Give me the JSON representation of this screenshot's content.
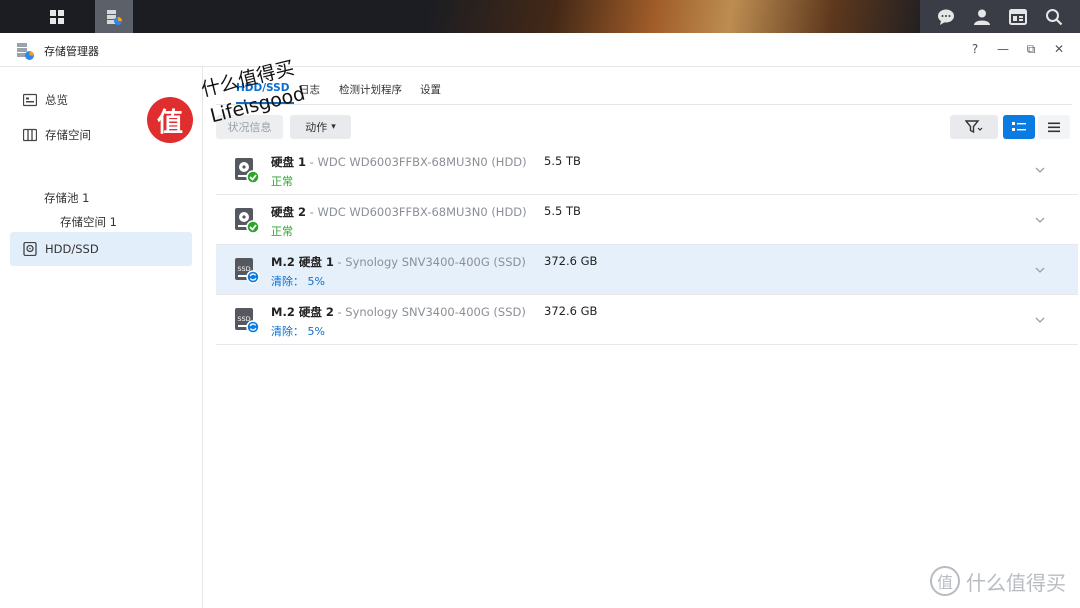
{
  "taskbar": {
    "apps": [
      {
        "icon": "main-menu-grid-icon"
      },
      {
        "icon": "storage-manager-icon",
        "active": true
      }
    ],
    "right_icons": [
      "chat-icon",
      "user-icon",
      "widgets-icon",
      "search-icon"
    ]
  },
  "window": {
    "title": "存储管理器",
    "controls": {
      "help": "?",
      "minimize": "—",
      "restore": "⧉",
      "close": "✕"
    }
  },
  "sidebar": {
    "items": [
      {
        "label": "总览",
        "icon": "overview-icon"
      },
      {
        "label": "存储空间",
        "icon": "storage-space-icon",
        "expanded": true
      },
      {
        "label": "HDD/SSD",
        "icon": "hdd-icon",
        "selected": true
      }
    ],
    "sub_items": [
      {
        "label": "存储池 1"
      },
      {
        "label": "存储空间 1"
      }
    ]
  },
  "tabs": [
    {
      "label": "HDD/SSD",
      "active": true
    },
    {
      "label": "日志"
    },
    {
      "label": "检测计划程序"
    },
    {
      "label": "设置"
    }
  ],
  "toolbar": {
    "status_info": "状况信息",
    "action": "动作",
    "action_caret": "▾"
  },
  "disks": [
    {
      "name": "硬盘 1",
      "model": " - WDC WD6003FFBX-68MU3N0 (HDD)",
      "size": "5.5 TB",
      "status": "正常",
      "status_type": "ok",
      "type": "hdd"
    },
    {
      "name": "硬盘 2",
      "model": " - WDC WD6003FFBX-68MU3N0 (HDD)",
      "size": "5.5 TB",
      "status": "正常",
      "status_type": "ok",
      "type": "hdd"
    },
    {
      "name": "M.2 硬盘 1",
      "model": " - Synology SNV3400-400G (SSD)",
      "size": "372.6 GB",
      "status": "清除：  5%",
      "status_type": "info",
      "type": "ssd",
      "highlight": true
    },
    {
      "name": "M.2 硬盘 2",
      "model": " - Synology SNV3400-400G (SSD)",
      "size": "372.6 GB",
      "status": "清除：  5%",
      "status_type": "info",
      "type": "ssd"
    }
  ],
  "watermark": {
    "logo_char": "值",
    "line1": "什么值得买",
    "line2": "Lifeisgood",
    "bottom_right": "什么值得买"
  },
  "colors": {
    "accent": "#0a6ed1",
    "ok_green": "#2aa52a",
    "selected_bg": "#e3eefb",
    "highlight_row": "#e6f0fb"
  }
}
